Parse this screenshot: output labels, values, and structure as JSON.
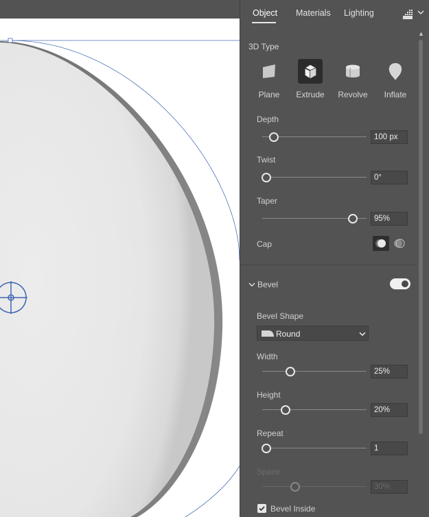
{
  "tabs": {
    "object": "Object",
    "materials": "Materials",
    "lighting": "Lighting"
  },
  "panel": {
    "type_section": "3D Type",
    "types": [
      {
        "label": "Plane",
        "icon": "plane-icon"
      },
      {
        "label": "Extrude",
        "icon": "extrude-icon",
        "selected": true
      },
      {
        "label": "Revolve",
        "icon": "revolve-icon"
      },
      {
        "label": "Inflate",
        "icon": "inflate-icon"
      }
    ],
    "depth": {
      "label": "Depth",
      "value": "100 px",
      "level": 0.08
    },
    "twist": {
      "label": "Twist",
      "value": "0°",
      "level": 0.0
    },
    "taper": {
      "label": "Taper",
      "value": "95%",
      "level": 0.9
    },
    "cap": {
      "label": "Cap"
    },
    "bevel": {
      "label": "Bevel",
      "enabled": true
    },
    "bevel_shape": {
      "label": "Bevel Shape",
      "value": "Round"
    },
    "width": {
      "label": "Width",
      "value": "25%",
      "level": 0.25
    },
    "height": {
      "label": "Height",
      "value": "20%",
      "level": 0.2
    },
    "repeat": {
      "label": "Repeat",
      "value": "1",
      "level": 0.0
    },
    "space": {
      "label": "Space",
      "value": "30%",
      "level": 0.3,
      "disabled": true
    },
    "bevel_inside": {
      "label": "Bevel Inside",
      "checked": true
    }
  },
  "colors": {
    "panel_bg": "#535353",
    "artboard": "#ffffff",
    "selection": "#4a6fb5"
  }
}
